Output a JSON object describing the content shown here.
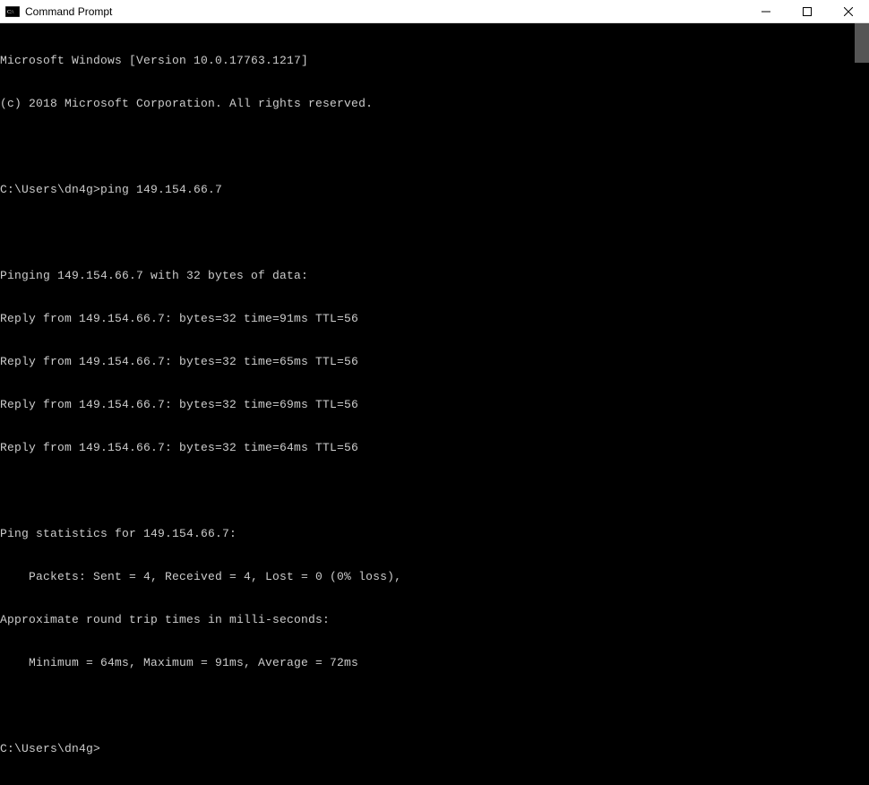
{
  "window": {
    "title": "Command Prompt"
  },
  "terminal": {
    "lines": [
      "Microsoft Windows [Version 10.0.17763.1217]",
      "(c) 2018 Microsoft Corporation. All rights reserved.",
      "",
      "C:\\Users\\dn4g>ping 149.154.66.7",
      "",
      "Pinging 149.154.66.7 with 32 bytes of data:",
      "Reply from 149.154.66.7: bytes=32 time=91ms TTL=56",
      "Reply from 149.154.66.7: bytes=32 time=65ms TTL=56",
      "Reply from 149.154.66.7: bytes=32 time=69ms TTL=56",
      "Reply from 149.154.66.7: bytes=32 time=64ms TTL=56",
      "",
      "Ping statistics for 149.154.66.7:",
      "    Packets: Sent = 4, Received = 4, Lost = 0 (0% loss),",
      "Approximate round trip times in milli-seconds:",
      "    Minimum = 64ms, Maximum = 91ms, Average = 72ms",
      "",
      "C:\\Users\\dn4g>"
    ]
  }
}
